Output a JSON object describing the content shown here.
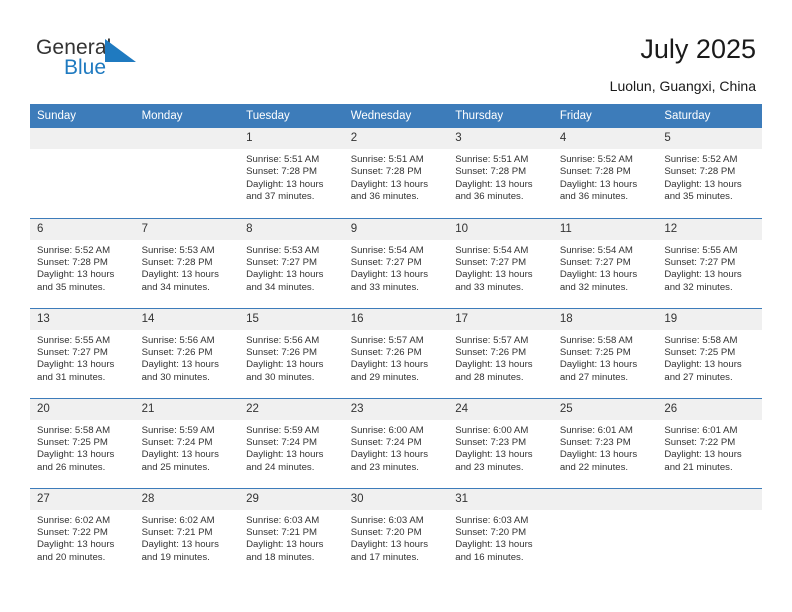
{
  "brand": {
    "name_top": "General",
    "name_bottom": "Blue",
    "triangle_icon": "blue-triangle-icon",
    "color_top": "#333333",
    "color_bottom": "#1f7ac0"
  },
  "header": {
    "title": "July 2025",
    "location": "Luolun, Guangxi, China"
  },
  "theme": {
    "header_blue": "#3d7cba",
    "daynum_bg": "#f0f0f0",
    "text": "#333333"
  },
  "calendar": {
    "weekday_headers": [
      "Sunday",
      "Monday",
      "Tuesday",
      "Wednesday",
      "Thursday",
      "Friday",
      "Saturday"
    ],
    "weeks": [
      [
        {
          "day": "",
          "empty": true
        },
        {
          "day": "",
          "empty": true
        },
        {
          "day": "1",
          "sunrise": "Sunrise: 5:51 AM",
          "sunset": "Sunset: 7:28 PM",
          "daylight": "Daylight: 13 hours and 37 minutes."
        },
        {
          "day": "2",
          "sunrise": "Sunrise: 5:51 AM",
          "sunset": "Sunset: 7:28 PM",
          "daylight": "Daylight: 13 hours and 36 minutes."
        },
        {
          "day": "3",
          "sunrise": "Sunrise: 5:51 AM",
          "sunset": "Sunset: 7:28 PM",
          "daylight": "Daylight: 13 hours and 36 minutes."
        },
        {
          "day": "4",
          "sunrise": "Sunrise: 5:52 AM",
          "sunset": "Sunset: 7:28 PM",
          "daylight": "Daylight: 13 hours and 36 minutes."
        },
        {
          "day": "5",
          "sunrise": "Sunrise: 5:52 AM",
          "sunset": "Sunset: 7:28 PM",
          "daylight": "Daylight: 13 hours and 35 minutes."
        }
      ],
      [
        {
          "day": "6",
          "sunrise": "Sunrise: 5:52 AM",
          "sunset": "Sunset: 7:28 PM",
          "daylight": "Daylight: 13 hours and 35 minutes."
        },
        {
          "day": "7",
          "sunrise": "Sunrise: 5:53 AM",
          "sunset": "Sunset: 7:28 PM",
          "daylight": "Daylight: 13 hours and 34 minutes."
        },
        {
          "day": "8",
          "sunrise": "Sunrise: 5:53 AM",
          "sunset": "Sunset: 7:27 PM",
          "daylight": "Daylight: 13 hours and 34 minutes."
        },
        {
          "day": "9",
          "sunrise": "Sunrise: 5:54 AM",
          "sunset": "Sunset: 7:27 PM",
          "daylight": "Daylight: 13 hours and 33 minutes."
        },
        {
          "day": "10",
          "sunrise": "Sunrise: 5:54 AM",
          "sunset": "Sunset: 7:27 PM",
          "daylight": "Daylight: 13 hours and 33 minutes."
        },
        {
          "day": "11",
          "sunrise": "Sunrise: 5:54 AM",
          "sunset": "Sunset: 7:27 PM",
          "daylight": "Daylight: 13 hours and 32 minutes."
        },
        {
          "day": "12",
          "sunrise": "Sunrise: 5:55 AM",
          "sunset": "Sunset: 7:27 PM",
          "daylight": "Daylight: 13 hours and 32 minutes."
        }
      ],
      [
        {
          "day": "13",
          "sunrise": "Sunrise: 5:55 AM",
          "sunset": "Sunset: 7:27 PM",
          "daylight": "Daylight: 13 hours and 31 minutes."
        },
        {
          "day": "14",
          "sunrise": "Sunrise: 5:56 AM",
          "sunset": "Sunset: 7:26 PM",
          "daylight": "Daylight: 13 hours and 30 minutes."
        },
        {
          "day": "15",
          "sunrise": "Sunrise: 5:56 AM",
          "sunset": "Sunset: 7:26 PM",
          "daylight": "Daylight: 13 hours and 30 minutes."
        },
        {
          "day": "16",
          "sunrise": "Sunrise: 5:57 AM",
          "sunset": "Sunset: 7:26 PM",
          "daylight": "Daylight: 13 hours and 29 minutes."
        },
        {
          "day": "17",
          "sunrise": "Sunrise: 5:57 AM",
          "sunset": "Sunset: 7:26 PM",
          "daylight": "Daylight: 13 hours and 28 minutes."
        },
        {
          "day": "18",
          "sunrise": "Sunrise: 5:58 AM",
          "sunset": "Sunset: 7:25 PM",
          "daylight": "Daylight: 13 hours and 27 minutes."
        },
        {
          "day": "19",
          "sunrise": "Sunrise: 5:58 AM",
          "sunset": "Sunset: 7:25 PM",
          "daylight": "Daylight: 13 hours and 27 minutes."
        }
      ],
      [
        {
          "day": "20",
          "sunrise": "Sunrise: 5:58 AM",
          "sunset": "Sunset: 7:25 PM",
          "daylight": "Daylight: 13 hours and 26 minutes."
        },
        {
          "day": "21",
          "sunrise": "Sunrise: 5:59 AM",
          "sunset": "Sunset: 7:24 PM",
          "daylight": "Daylight: 13 hours and 25 minutes."
        },
        {
          "day": "22",
          "sunrise": "Sunrise: 5:59 AM",
          "sunset": "Sunset: 7:24 PM",
          "daylight": "Daylight: 13 hours and 24 minutes."
        },
        {
          "day": "23",
          "sunrise": "Sunrise: 6:00 AM",
          "sunset": "Sunset: 7:24 PM",
          "daylight": "Daylight: 13 hours and 23 minutes."
        },
        {
          "day": "24",
          "sunrise": "Sunrise: 6:00 AM",
          "sunset": "Sunset: 7:23 PM",
          "daylight": "Daylight: 13 hours and 23 minutes."
        },
        {
          "day": "25",
          "sunrise": "Sunrise: 6:01 AM",
          "sunset": "Sunset: 7:23 PM",
          "daylight": "Daylight: 13 hours and 22 minutes."
        },
        {
          "day": "26",
          "sunrise": "Sunrise: 6:01 AM",
          "sunset": "Sunset: 7:22 PM",
          "daylight": "Daylight: 13 hours and 21 minutes."
        }
      ],
      [
        {
          "day": "27",
          "sunrise": "Sunrise: 6:02 AM",
          "sunset": "Sunset: 7:22 PM",
          "daylight": "Daylight: 13 hours and 20 minutes."
        },
        {
          "day": "28",
          "sunrise": "Sunrise: 6:02 AM",
          "sunset": "Sunset: 7:21 PM",
          "daylight": "Daylight: 13 hours and 19 minutes."
        },
        {
          "day": "29",
          "sunrise": "Sunrise: 6:03 AM",
          "sunset": "Sunset: 7:21 PM",
          "daylight": "Daylight: 13 hours and 18 minutes."
        },
        {
          "day": "30",
          "sunrise": "Sunrise: 6:03 AM",
          "sunset": "Sunset: 7:20 PM",
          "daylight": "Daylight: 13 hours and 17 minutes."
        },
        {
          "day": "31",
          "sunrise": "Sunrise: 6:03 AM",
          "sunset": "Sunset: 7:20 PM",
          "daylight": "Daylight: 13 hours and 16 minutes."
        },
        {
          "day": "",
          "empty": true
        },
        {
          "day": "",
          "empty": true
        }
      ]
    ]
  }
}
